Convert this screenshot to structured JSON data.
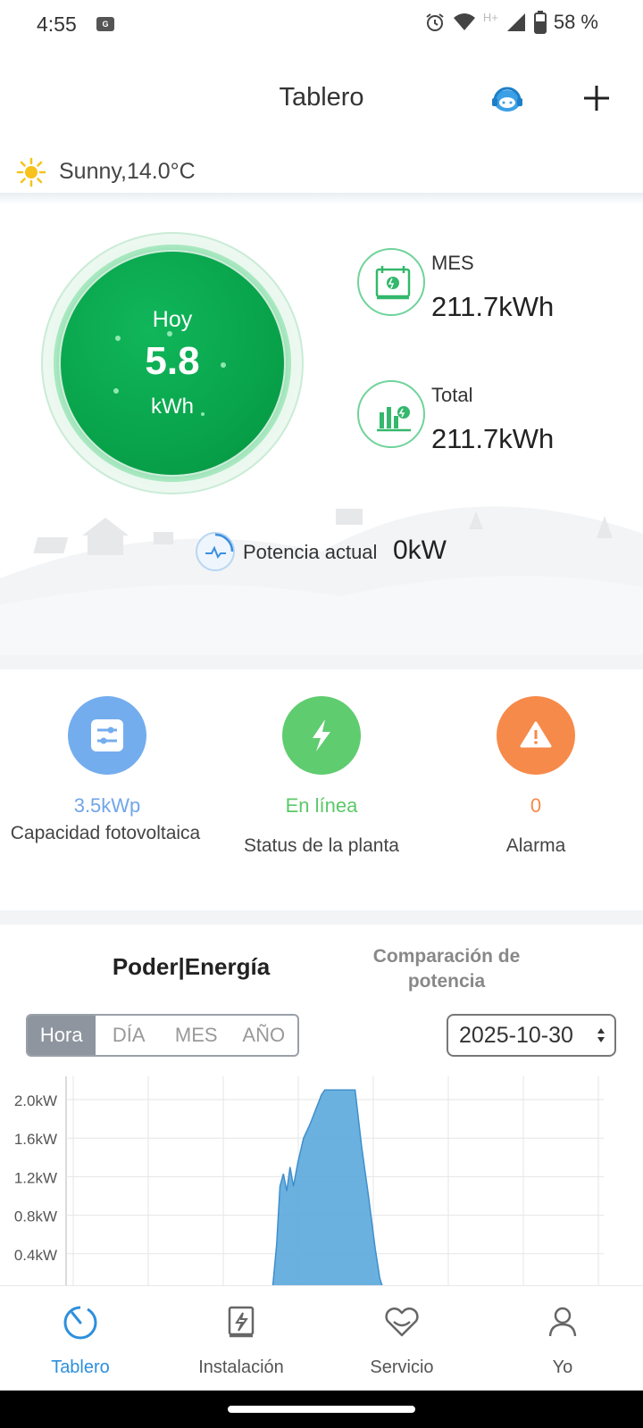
{
  "status_bar": {
    "time": "4:55",
    "notification": "G",
    "network": "H+",
    "battery": "58 %"
  },
  "header": {
    "title": "Tablero"
  },
  "weather": {
    "text": "Sunny,14.0°C",
    "icon": "sun-icon"
  },
  "energy": {
    "today_label": "Hoy",
    "today_value": "5.8",
    "today_unit": "kWh",
    "month_label": "MES",
    "month_value": "211.7kWh",
    "total_label": "Total",
    "total_value": "211.7kWh",
    "current_power_label": "Potencia actual",
    "current_power_value": "0kW"
  },
  "status": {
    "capacity": {
      "value": "3.5kWp",
      "label": "Capacidad fotovoltaica",
      "color": "#6fa6e8"
    },
    "plant": {
      "value": "En línea",
      "label": "Status de la planta",
      "color": "#5cc86a"
    },
    "alarm": {
      "value": "0",
      "label": "Alarma",
      "color": "#f5894a"
    }
  },
  "chart_section": {
    "tab_main": "Poder|Energía",
    "tab_compare": "Comparación de potencia",
    "segments": [
      "Hora",
      "DÍA",
      "MES",
      "AÑO"
    ],
    "active_segment": "Hora",
    "date": "2025-10-30"
  },
  "chart_data": {
    "type": "area",
    "y_tick_labels": [
      "2.0kW",
      "1.6kW",
      "1.2kW",
      "0.8kW",
      "0.4kW"
    ],
    "ylim": [
      0,
      2.4
    ],
    "grid": true,
    "series_color": "#5ba8dc",
    "x": [
      7,
      9.2,
      9.4,
      9.55,
      9.7,
      9.85,
      10.0,
      10.15,
      10.35,
      10.6,
      10.9,
      11.15,
      11.4,
      11.55,
      11.8,
      12.9,
      13.2,
      13.5,
      13.8,
      14.0,
      14.2,
      16
    ],
    "values": [
      0,
      0,
      0.5,
      1.1,
      1.23,
      1.05,
      1.3,
      1.1,
      1.35,
      1.6,
      1.75,
      1.9,
      2.05,
      2.1,
      2.1,
      2.1,
      1.5,
      1.0,
      0.45,
      0.15,
      0,
      0
    ]
  },
  "nav": [
    {
      "label": "Tablero",
      "icon": "dashboard-icon",
      "active": true
    },
    {
      "label": "Instalación",
      "icon": "installation-icon",
      "active": false
    },
    {
      "label": "Servicio",
      "icon": "service-icon",
      "active": false
    },
    {
      "label": "Yo",
      "icon": "user-icon",
      "active": false
    }
  ]
}
